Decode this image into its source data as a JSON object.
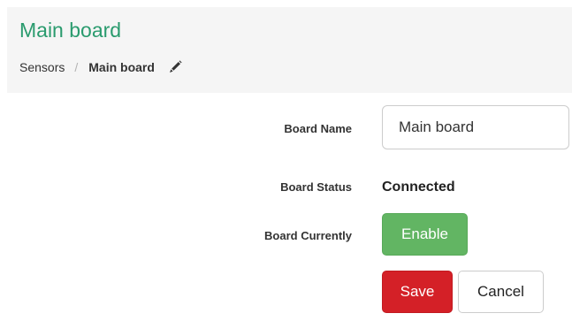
{
  "header": {
    "title": "Main board",
    "breadcrumb": {
      "parent": "Sensors",
      "separator": "/",
      "current": "Main board"
    },
    "edit_icon": "pencil-icon"
  },
  "form": {
    "board_name": {
      "label": "Board Name",
      "value": "Main board"
    },
    "board_status": {
      "label": "Board Status",
      "value": "Connected"
    },
    "board_currently": {
      "label": "Board Currently",
      "button": "Enable"
    }
  },
  "actions": {
    "save": "Save",
    "cancel": "Cancel"
  },
  "colors": {
    "title": "#2a9b6e",
    "enable": "#62b563",
    "save": "#d42027",
    "header_background": "#f5f5f5"
  }
}
